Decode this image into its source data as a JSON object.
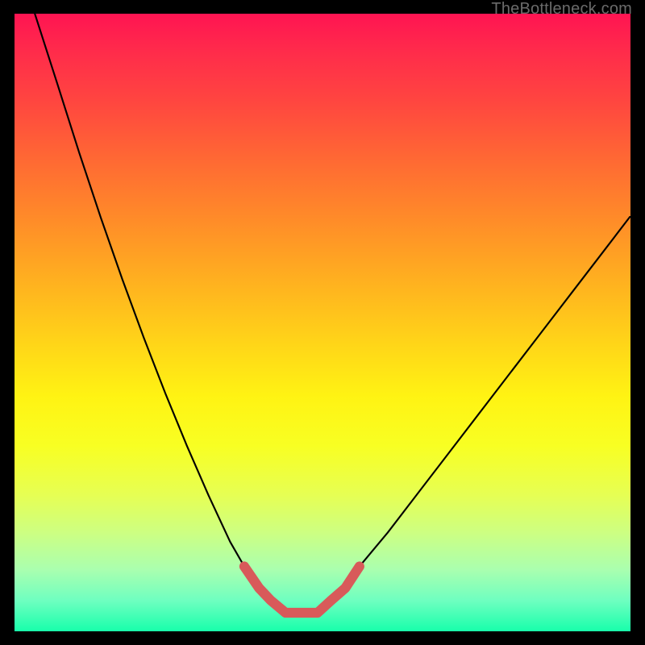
{
  "watermark": "TheBottleneck.com",
  "colors": {
    "stroke_curve": "#000000",
    "stroke_highlight": "#d85a5a",
    "gradient_top": "#ff1452",
    "gradient_bottom": "#18ffab",
    "page_bg": "#000000"
  },
  "chart_data": {
    "type": "line",
    "title": "",
    "xlabel": "",
    "ylabel": "",
    "xlim": [
      0,
      100
    ],
    "ylim": [
      0,
      100
    ],
    "grid": false,
    "legend": "none",
    "series": [
      {
        "name": "bottleneck-curve",
        "x": [
          3.3,
          7,
          10.5,
          14,
          17.5,
          21,
          24.5,
          28,
          31.5,
          35,
          37.3,
          39.7,
          41.6,
          44,
          49.2,
          51.4,
          53.7,
          56,
          60.6,
          65.6,
          70.6,
          75.6,
          80.6,
          85.6,
          90.6,
          95.6,
          99.9
        ],
        "y": [
          100,
          88.5,
          77.5,
          67,
          57,
          47.5,
          38.5,
          30,
          22,
          14.5,
          10.5,
          7,
          5,
          3,
          3,
          5,
          7,
          10.5,
          16,
          22.5,
          29,
          35.5,
          42,
          48.5,
          55,
          61.5,
          67.1
        ]
      },
      {
        "name": "highlight-band",
        "x": [
          37.3,
          39.7,
          41.6,
          44,
          49.2,
          51.4,
          53.7,
          56
        ],
        "y": [
          10.5,
          7,
          5,
          3,
          3,
          5,
          7,
          10.5
        ]
      }
    ],
    "annotations": []
  }
}
